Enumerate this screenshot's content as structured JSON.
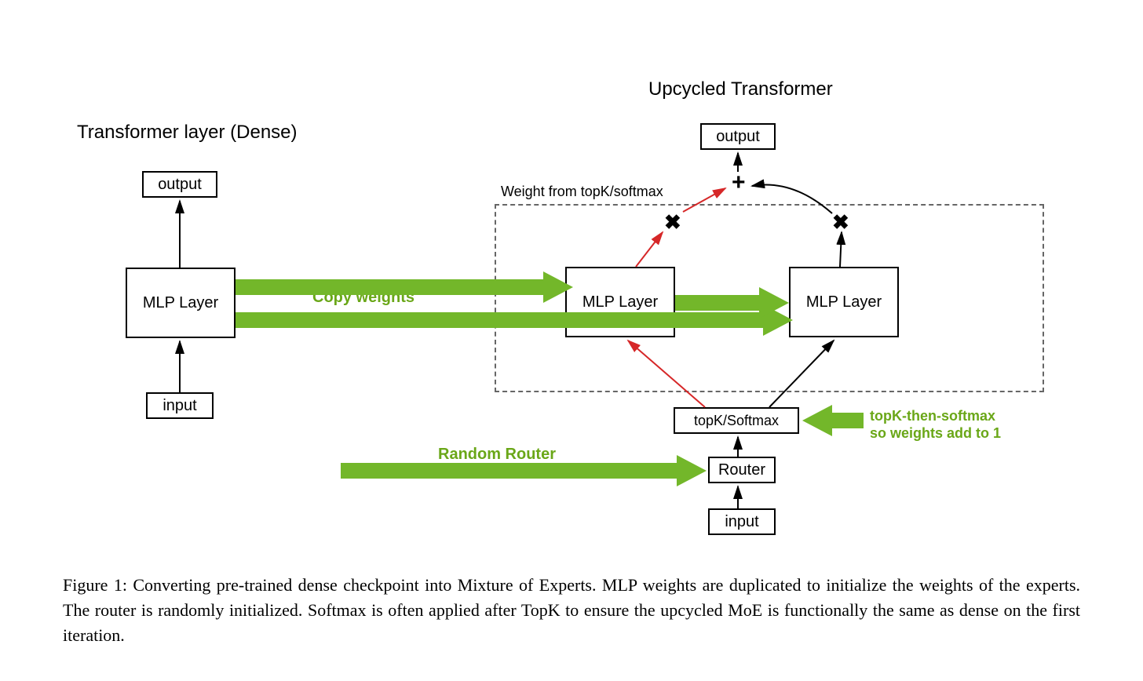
{
  "titles": {
    "left": "Transformer layer (Dense)",
    "right": "Upcycled Transformer"
  },
  "left": {
    "output": "output",
    "mlp": "MLP Layer",
    "input": "input"
  },
  "right": {
    "output": "output",
    "mlp1": "MLP Layer",
    "mlp2": "MLP Layer",
    "topk": "topK/Softmax",
    "router": "Router",
    "input": "input",
    "weight_label": "Weight from topK/softmax"
  },
  "green": {
    "copy": "Copy weights",
    "random": "Random Router",
    "note_l1": "topK-then-softmax",
    "note_l2": "so weights add to 1"
  },
  "symbols": {
    "plus": "+",
    "x": "✖"
  },
  "caption": "Figure 1: Converting pre-trained dense checkpoint into Mixture of Experts. MLP weights are duplicated to initialize the weights of the experts. The router is randomly initialized. Softmax is often applied after TopK to ensure the upcycled MoE is functionally the same as dense on the first iteration.",
  "colors": {
    "green": "#73b72a",
    "green_text": "#6aa718",
    "red": "#d62728",
    "black": "#000000"
  }
}
